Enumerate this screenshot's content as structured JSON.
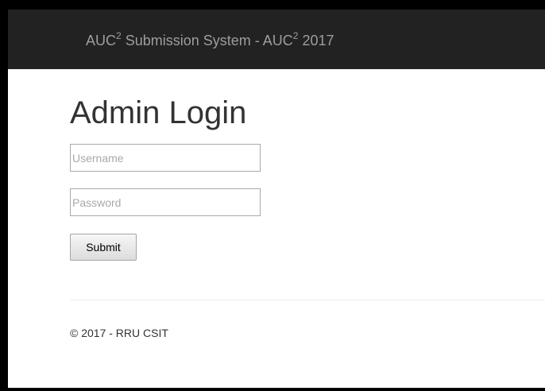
{
  "navbar": {
    "brand_prefix": "AUC",
    "brand_sup_1": "2",
    "brand_middle": " Submission System - AUC",
    "brand_sup_2": "2",
    "brand_suffix": " 2017",
    "background_color": "#222222",
    "text_color": "#9d9d9d"
  },
  "main": {
    "title": "Admin Login",
    "username": {
      "placeholder": "Username",
      "value": ""
    },
    "password": {
      "placeholder": "Password",
      "value": ""
    },
    "submit_label": "Submit"
  },
  "footer": {
    "text": "© 2017 - RRU CSIT"
  }
}
